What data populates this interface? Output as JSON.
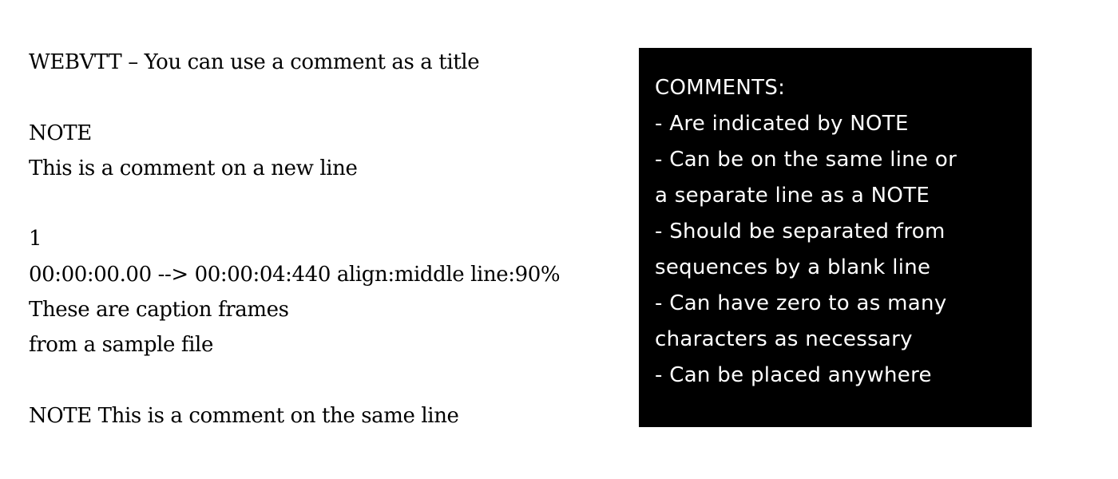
{
  "document": {
    "vtt_lines": [
      "WEBVTT – You can use a comment as a title",
      "",
      "NOTE",
      "This is a comment on a new line",
      "",
      "1",
      "00:00:00.00 --> 00:00:04:440 align:middle line:90%",
      "These are caption frames",
      "from a sample file",
      "",
      "NOTE This is a comment on the same line"
    ]
  },
  "comments_box": {
    "title": "COMMENTS:",
    "lines": [
      "- Are indicated by NOTE",
      "- Can be on the same line or",
      "a separate line as a NOTE",
      "- Should be separated from",
      "sequences by a blank line",
      "- Can have zero to as many",
      "characters as necessary",
      "- Can be placed anywhere"
    ]
  }
}
